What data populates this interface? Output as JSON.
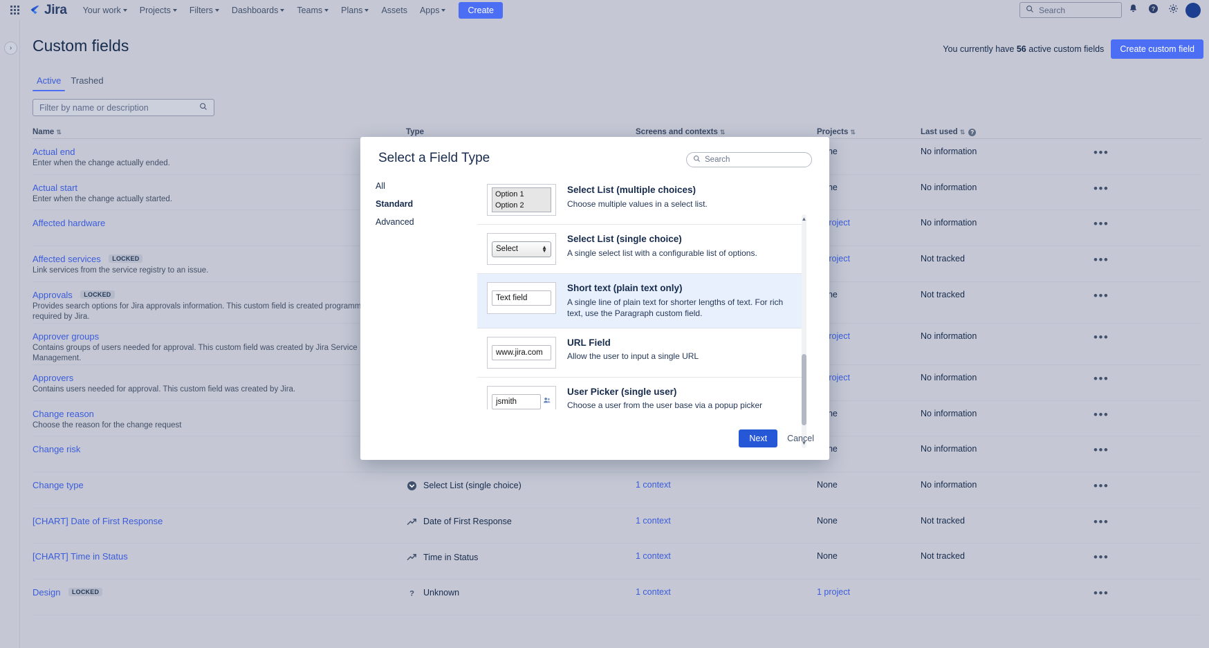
{
  "topnav": {
    "app_switcher_icon": "grid-apps-icon",
    "logo_text": "Jira",
    "items": [
      {
        "label": "Your work",
        "has_caret": true
      },
      {
        "label": "Projects",
        "has_caret": true
      },
      {
        "label": "Filters",
        "has_caret": true
      },
      {
        "label": "Dashboards",
        "has_caret": true
      },
      {
        "label": "Teams",
        "has_caret": true
      },
      {
        "label": "Plans",
        "has_caret": true
      },
      {
        "label": "Assets",
        "has_caret": false
      },
      {
        "label": "Apps",
        "has_caret": true
      }
    ],
    "create_label": "Create",
    "search_placeholder": "Search",
    "notifications_icon": "bell-icon",
    "help_icon": "question-circle-icon",
    "settings_icon": "gear-icon",
    "avatar": "user-avatar"
  },
  "header": {
    "title": "Custom fields",
    "count_prefix": "You currently have ",
    "count_value": "56",
    "count_suffix": " active custom fields",
    "create_custom_field_label": "Create custom field"
  },
  "tabs": [
    {
      "label": "Active",
      "active": true
    },
    {
      "label": "Trashed",
      "active": false
    }
  ],
  "filter": {
    "placeholder": "Filter by name or description",
    "value": "",
    "icon": "search-icon"
  },
  "table": {
    "columns": [
      {
        "label": "Name",
        "sortable": true
      },
      {
        "label": "Type",
        "sortable": false
      },
      {
        "label": "Screens and contexts",
        "sortable": true
      },
      {
        "label": "Projects",
        "sortable": true
      },
      {
        "label": "Last used",
        "sortable": true,
        "info": true
      }
    ],
    "rows": [
      {
        "name": "Actual end",
        "locked": false,
        "description": "Enter when the change actually ended.",
        "type": "",
        "type_icon": "",
        "screens": "",
        "projects": "None",
        "last_used": "No information"
      },
      {
        "name": "Actual start",
        "locked": false,
        "description": "Enter when the change actually started.",
        "type": "",
        "type_icon": "",
        "screens": "",
        "projects": "None",
        "last_used": "No information"
      },
      {
        "name": "Affected hardware",
        "locked": false,
        "description": "",
        "type": "",
        "type_icon": "",
        "screens": "",
        "projects": "1 project",
        "last_used": "No information"
      },
      {
        "name": "Affected services",
        "locked": true,
        "locked_label": "LOCKED",
        "description": "Link services from the service registry to an issue.",
        "type": "",
        "type_icon": "",
        "screens": "",
        "projects": "1 project",
        "last_used": "Not tracked"
      },
      {
        "name": "Approvals",
        "locked": true,
        "locked_label": "LOCKED",
        "description": "Provides search options for Jira approvals information. This custom field is created programmatically and required by Jira.",
        "type": "",
        "type_icon": "",
        "screens": "",
        "projects": "None",
        "last_used": "Not tracked"
      },
      {
        "name": "Approver groups",
        "locked": false,
        "description": "Contains groups of users needed for approval. This custom field was created by Jira Service Management.",
        "type": "",
        "type_icon": "",
        "screens": "",
        "projects": "1 project",
        "last_used": "No information"
      },
      {
        "name": "Approvers",
        "locked": false,
        "description": "Contains users needed for approval. This custom field was created by Jira.",
        "type": "",
        "type_icon": "",
        "screens": "",
        "projects": "1 project",
        "last_used": "No information"
      },
      {
        "name": "Change reason",
        "locked": false,
        "description": "Choose the reason for the change request",
        "type": "",
        "type_icon": "",
        "screens": "",
        "projects": "None",
        "last_used": "No information"
      },
      {
        "name": "Change risk",
        "locked": false,
        "description": "",
        "type": "",
        "type_icon": "",
        "screens": "",
        "projects": "None",
        "last_used": "No information"
      },
      {
        "name": "Change type",
        "locked": false,
        "description": "",
        "type": "Select List (single choice)",
        "type_icon": "select-list-icon",
        "screens": "1 context",
        "projects": "None",
        "last_used": "No information"
      },
      {
        "name": "[CHART] Date of First Response",
        "locked": false,
        "description": "",
        "type": "Date of First Response",
        "type_icon": "chart-trend-icon",
        "screens": "1 context",
        "projects": "None",
        "last_used": "Not tracked"
      },
      {
        "name": "[CHART] Time in Status",
        "locked": false,
        "description": "",
        "type": "Time in Status",
        "type_icon": "chart-trend-icon",
        "screens": "1 context",
        "projects": "None",
        "last_used": "Not tracked"
      },
      {
        "name": "Design",
        "locked": true,
        "locked_label": "LOCKED",
        "description": "",
        "type": "Unknown",
        "type_icon": "unknown-icon",
        "screens": "1 context",
        "projects": "1 project",
        "last_used": ""
      }
    ],
    "row_actions_icon": "more-actions-icon"
  },
  "modal": {
    "title": "Select a Field Type",
    "search_placeholder": "Search",
    "search_value": "",
    "search_icon": "search-icon",
    "categories": [
      {
        "label": "All",
        "selected": false
      },
      {
        "label": "Standard",
        "selected": true
      },
      {
        "label": "Advanced",
        "selected": false
      }
    ],
    "field_types": [
      {
        "name": "Select List (multiple choices)",
        "description": "Choose multiple values in a select list.",
        "preview_kind": "multi-select",
        "preview_lines": [
          "Option 1",
          "Option 2"
        ],
        "selected": false
      },
      {
        "name": "Select List (single choice)",
        "description": "A single select list with a configurable list of options.",
        "preview_kind": "single-select",
        "preview_text": "Select",
        "selected": false
      },
      {
        "name": "Short text (plain text only)",
        "description": "A single line of plain text for shorter lengths of text. For rich text, use the Paragraph custom field.",
        "preview_kind": "text",
        "preview_text": "Text field",
        "selected": true
      },
      {
        "name": "URL Field",
        "description": "Allow the user to input a single URL",
        "preview_kind": "text",
        "preview_text": "www.jira.com",
        "selected": false
      },
      {
        "name": "User Picker (single user)",
        "description": "Choose a user from the user base via a popup picker window.",
        "preview_kind": "user",
        "preview_text": "jsmith",
        "preview_icon": "user-picker-icon",
        "selected": false
      }
    ],
    "next_label": "Next",
    "cancel_label": "Cancel",
    "scrollbar": "vertical-scrollbar"
  },
  "colors": {
    "brand_blue": "#4c6ef5",
    "link_blue": "#3b5bdb",
    "page_bg": "#c5c8d4",
    "modal_bg": "#ffffff",
    "selected_row": "#e9f0fd",
    "next_button": "#2557d6"
  }
}
